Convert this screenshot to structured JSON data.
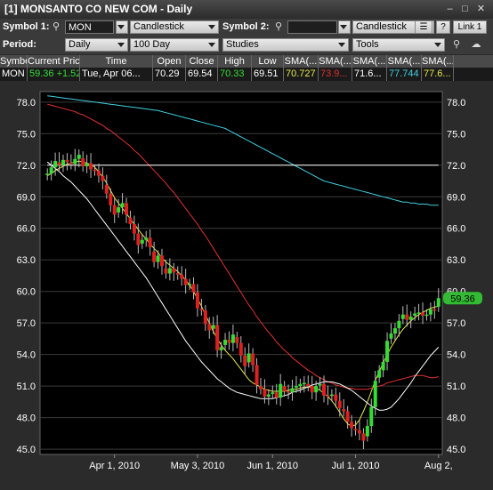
{
  "window": {
    "title": "[1] MONSANTO CO NEW COM - Daily",
    "min_icon": "minimize-icon",
    "max_icon": "maximize-icon",
    "close_icon": "close-icon"
  },
  "toolbar1": {
    "symbol1_label": "Symbol 1:",
    "symbol1_value": "MON",
    "chart_style": "Candlestick",
    "symbol2_label": "Symbol 2:",
    "symbol2_value": "",
    "chart_style2": "Candlestick",
    "help_label": "?",
    "link_label": "Link 1"
  },
  "toolbar2": {
    "period_label": "Period:",
    "period_value": "Daily",
    "range_value": "100 Day",
    "studies_value": "Studies",
    "tools_value": "Tools"
  },
  "quote": {
    "headers": [
      "Symbol",
      "Current Price",
      "Time",
      "Open",
      "Close",
      "High",
      "Low",
      "SMA(...",
      "SMA(...",
      "SMA(...",
      "SMA(...",
      "SMA(..."
    ],
    "values": [
      "MON",
      "59.36  +1.52 (...",
      "Tue, Apr 06...",
      "70.29",
      "69.54",
      "70.33",
      "69.51",
      "70.727",
      "73.9...",
      "71.6...",
      "77.744",
      "77.6..."
    ],
    "colors": {
      "price": "#33dd33",
      "high": "#33dd33",
      "sma1": "#e8e84a",
      "sma2": "#e03030",
      "sma3": "#ffffff",
      "sma4": "#40d0e0",
      "sma5": "#e8e84a"
    }
  },
  "chart_data": {
    "type": "candlestick",
    "symbol": "MON",
    "y_ticks": [
      78.0,
      75.0,
      72.0,
      69.0,
      66.0,
      63.0,
      60.0,
      57.0,
      54.0,
      51.0,
      48.0,
      45.0
    ],
    "ylim": [
      44.5,
      79.0
    ],
    "x_labels": [
      "Apr 1, 2010",
      "May 3, 2010",
      "Jun 1, 2010",
      "Jul 1, 2010",
      "Aug 2,"
    ],
    "x_label_index": [
      17,
      38,
      57,
      78,
      99
    ],
    "current_price": "59.36",
    "closes": [
      71.2,
      71.8,
      72.4,
      72.0,
      72.5,
      72.3,
      72.1,
      72.6,
      73.0,
      71.9,
      72.2,
      71.6,
      71.5,
      71.0,
      70.5,
      69.3,
      68.2,
      67.3,
      68.0,
      68.4,
      67.3,
      66.4,
      65.5,
      64.4,
      64.9,
      65.1,
      64.2,
      62.8,
      63.4,
      62.4,
      61.7,
      62.2,
      61.8,
      61.6,
      61.2,
      60.6,
      60.7,
      59.9,
      58.4,
      58.2,
      56.9,
      56.3,
      56.8,
      54.4,
      54.7,
      55.4,
      55.1,
      55.9,
      55.1,
      53.9,
      52.9,
      54.1,
      53.0,
      51.1,
      50.7,
      50.0,
      50.2,
      50.4,
      49.9,
      51.2,
      50.5,
      50.4,
      50.8,
      51.0,
      51.2,
      51.3,
      51.0,
      50.4,
      51.0,
      51.2,
      50.1,
      50.0,
      50.2,
      49.6,
      48.9,
      48.6,
      47.6,
      47.0,
      46.8,
      46.5,
      45.8,
      47.2,
      49.0,
      51.5,
      52.5,
      53.3,
      55.3,
      56.0,
      56.5,
      57.2,
      57.8,
      57.3,
      57.6,
      57.9,
      58.0,
      57.7,
      57.8,
      58.3,
      58.2,
      59.36
    ],
    "series": [
      {
        "name": "SMA 1",
        "color": "#e8e84a",
        "values": [
          71.0,
          71.2,
          71.5,
          71.7,
          71.9,
          72.1,
          72.2,
          72.3,
          72.4,
          72.3,
          72.2,
          72.0,
          71.8,
          71.4,
          70.9,
          70.3,
          69.6,
          68.9,
          68.4,
          67.9,
          67.4,
          66.9,
          66.4,
          65.9,
          65.4,
          65.0,
          64.5,
          64.1,
          63.7,
          63.2,
          62.8,
          62.5,
          62.2,
          61.9,
          61.5,
          61.1,
          60.6,
          60.0,
          59.3,
          58.6,
          57.8,
          57.0,
          56.2,
          55.5,
          54.9,
          54.4,
          54.0,
          53.6,
          53.1,
          52.6,
          52.1,
          51.6,
          51.3,
          51.1,
          50.9,
          50.7,
          50.6,
          50.5,
          50.5,
          50.5,
          50.5,
          50.6,
          50.7,
          50.7,
          50.8,
          50.9,
          50.9,
          50.9,
          50.8,
          50.6,
          50.3,
          50.0,
          49.6,
          49.1,
          48.5,
          47.9,
          47.4,
          47.2,
          47.3,
          47.8,
          48.6,
          49.5,
          50.5,
          51.5,
          52.4,
          53.2,
          54.0,
          54.7,
          55.3,
          55.9,
          56.4,
          56.8,
          57.2,
          57.5,
          57.8,
          58.0,
          58.2,
          58.4,
          58.5,
          58.6
        ]
      },
      {
        "name": "SMA 2",
        "color": "#e03030",
        "values": [
          77.8,
          77.7,
          77.6,
          77.5,
          77.4,
          77.3,
          77.2,
          77.1,
          76.9,
          76.8,
          76.6,
          76.4,
          76.2,
          76.0,
          75.8,
          75.5,
          75.3,
          75.0,
          74.7,
          74.4,
          74.1,
          73.8,
          73.4,
          73.1,
          72.7,
          72.3,
          71.9,
          71.5,
          71.1,
          70.7,
          70.3,
          69.8,
          69.4,
          68.9,
          68.4,
          67.9,
          67.4,
          66.9,
          66.4,
          65.8,
          65.3,
          64.7,
          64.1,
          63.5,
          62.9,
          62.3,
          61.7,
          61.1,
          60.5,
          59.9,
          59.3,
          58.7,
          58.2,
          57.6,
          57.1,
          56.6,
          56.1,
          55.7,
          55.2,
          54.8,
          54.4,
          54.1,
          53.7,
          53.4,
          53.1,
          52.8,
          52.5,
          52.3,
          52.0,
          51.8,
          51.6,
          51.4,
          51.3,
          51.1,
          51.0,
          50.9,
          50.8,
          50.8,
          50.7,
          50.7,
          50.7,
          50.7,
          50.8,
          50.9,
          51.0,
          51.1,
          51.3,
          51.4,
          51.5,
          51.6,
          51.7,
          51.8,
          51.9,
          52.0,
          52.0,
          52.0,
          51.9,
          51.8,
          51.8,
          51.9
        ]
      },
      {
        "name": "SMA 3",
        "color": "#ffffff",
        "values": [
          72.3,
          72.0,
          71.7,
          71.4,
          71.0,
          70.7,
          70.4,
          70.0,
          69.6,
          69.2,
          68.8,
          68.3,
          67.8,
          67.3,
          66.8,
          66.3,
          65.8,
          65.3,
          64.8,
          64.3,
          63.8,
          63.3,
          62.8,
          62.3,
          61.8,
          61.3,
          60.7,
          60.1,
          59.5,
          58.9,
          58.3,
          57.7,
          57.1,
          56.5,
          55.9,
          55.3,
          54.8,
          54.3,
          53.8,
          53.3,
          52.9,
          52.5,
          52.1,
          51.7,
          51.4,
          51.1,
          50.8,
          50.6,
          50.4,
          50.3,
          50.2,
          50.1,
          50.0,
          49.9,
          49.8,
          49.8,
          49.8,
          49.8,
          49.9,
          50.0,
          50.1,
          50.2,
          50.4,
          50.5,
          50.6,
          50.8,
          50.9,
          51.1,
          51.2,
          51.3,
          51.4,
          51.4,
          51.4,
          51.3,
          51.2,
          51.0,
          50.8,
          50.6,
          50.3,
          50.0,
          49.7,
          49.4,
          49.1,
          48.9,
          48.7,
          48.7,
          48.8,
          49.0,
          49.4,
          49.8,
          50.3,
          50.8,
          51.3,
          51.9,
          52.4,
          52.9,
          53.4,
          53.9,
          54.3,
          54.7
        ]
      },
      {
        "name": "SMA 4",
        "color": "#40d0e0",
        "values": [
          78.6,
          78.55,
          78.5,
          78.45,
          78.4,
          78.35,
          78.3,
          78.25,
          78.2,
          78.15,
          78.1,
          78.05,
          78.0,
          77.95,
          77.9,
          77.85,
          77.8,
          77.75,
          77.7,
          77.65,
          77.6,
          77.55,
          77.5,
          77.45,
          77.4,
          77.35,
          77.3,
          77.25,
          77.2,
          77.1,
          77.0,
          76.9,
          76.8,
          76.7,
          76.6,
          76.5,
          76.4,
          76.3,
          76.2,
          76.1,
          76.0,
          75.9,
          75.8,
          75.7,
          75.6,
          75.5,
          75.3,
          75.1,
          74.9,
          74.7,
          74.5,
          74.3,
          74.1,
          73.9,
          73.7,
          73.5,
          73.3,
          73.1,
          72.9,
          72.7,
          72.5,
          72.3,
          72.1,
          71.9,
          71.7,
          71.5,
          71.3,
          71.1,
          70.9,
          70.7,
          70.5,
          70.4,
          70.3,
          70.2,
          70.1,
          70.0,
          69.9,
          69.8,
          69.7,
          69.6,
          69.5,
          69.4,
          69.3,
          69.2,
          69.1,
          69.0,
          68.9,
          68.8,
          68.7,
          68.6,
          68.5,
          68.5,
          68.4,
          68.4,
          68.3,
          68.3,
          68.3,
          68.2,
          68.2,
          68.2
        ]
      },
      {
        "name": "SMA 5",
        "color": "#ffffff",
        "values": [
          72.0,
          72.0,
          72.0,
          72.0,
          72.0,
          72.0,
          72.0,
          72.0,
          72.0,
          72.0,
          72.0,
          72.0,
          72.0,
          72.0,
          72.0,
          72.0,
          72.0,
          72.0,
          72.0,
          72.0,
          72.0,
          72.0,
          72.0,
          72.0,
          72.0,
          72.0,
          72.0,
          72.0,
          72.0,
          72.0,
          72.0,
          72.0,
          72.0,
          72.0,
          72.0,
          72.0,
          72.0,
          72.0,
          72.0,
          72.0,
          72.0,
          72.0,
          72.0,
          72.0,
          72.0,
          72.0,
          72.0,
          72.0,
          72.0,
          72.0,
          72.0,
          72.0,
          72.0,
          72.0,
          72.0,
          72.0,
          72.0,
          72.0,
          72.0,
          72.0,
          72.0,
          72.0,
          72.0,
          72.0,
          72.0,
          72.0,
          72.0,
          72.0,
          72.0,
          72.0,
          72.0,
          72.0,
          72.0,
          72.0,
          72.0,
          72.0,
          72.0,
          72.0,
          72.0,
          72.0,
          72.0,
          72.0,
          72.0,
          72.0,
          72.0,
          72.0,
          72.0,
          72.0,
          72.0,
          72.0,
          72.0,
          72.0,
          72.0,
          72.0,
          72.0,
          72.0,
          72.0,
          72.0,
          72.0,
          72.0
        ]
      }
    ],
    "up_color": "#33dd33",
    "down_color": "#dd2020",
    "grid": true
  }
}
